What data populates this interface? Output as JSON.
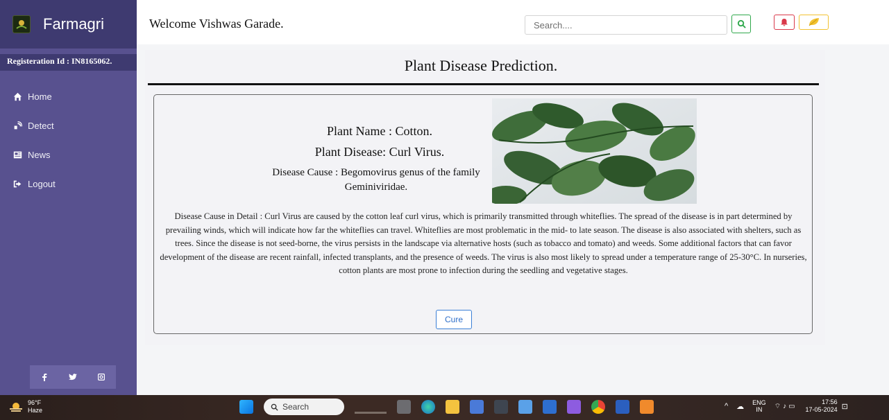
{
  "sidebar": {
    "brand": "Farmagri",
    "registration": "Registeration Id : IN8165062.",
    "nav": [
      {
        "label": "Home"
      },
      {
        "label": "Detect"
      },
      {
        "label": "News"
      },
      {
        "label": "Logout"
      }
    ]
  },
  "header": {
    "welcome": "Welcome Vishwas Garade.",
    "search_placeholder": "Search...."
  },
  "main": {
    "title": "Plant Disease Prediction.",
    "plant_name": "Plant Name : Cotton.",
    "plant_disease": "Plant Disease: Curl Virus.",
    "disease_cause": "Disease Cause : Begomovirus genus of the family Geminiviridae.",
    "detail": "Disease Cause in Detail : Curl Virus are caused by the cotton leaf curl virus, which is primarily transmitted through whiteflies. The spread of the disease is in part determined by prevailing winds, which will indicate how far the whiteflies can travel. Whiteflies are most problematic in the mid- to late season. The disease is also associated with shelters, such as trees. Since the disease is not seed-borne, the virus persists in the landscape via alternative hosts (such as tobacco and tomato) and weeds. Some additional factors that can favor development of the disease are recent rainfall, infected transplants, and the presence of weeds. The virus is also most likely to spread under a temperature range of 25-30°C. In nurseries, cotton plants are most prone to infection during the seedling and vegetative stages.",
    "cure_label": "Cure"
  },
  "taskbar": {
    "temperature": "96°F",
    "weather": "Haze",
    "search_label": "Search",
    "lang_top": "ENG",
    "lang_bottom": "IN",
    "time": "17:56",
    "date": "17-05-2024"
  },
  "colors": {
    "sidebar": "#58518f",
    "sidebar_dark": "#3e3a70",
    "search_green": "#2ea84b",
    "bell_red": "#d9384a",
    "leaf_yellow": "#f2c230",
    "cure_blue": "#3a7fd6"
  }
}
